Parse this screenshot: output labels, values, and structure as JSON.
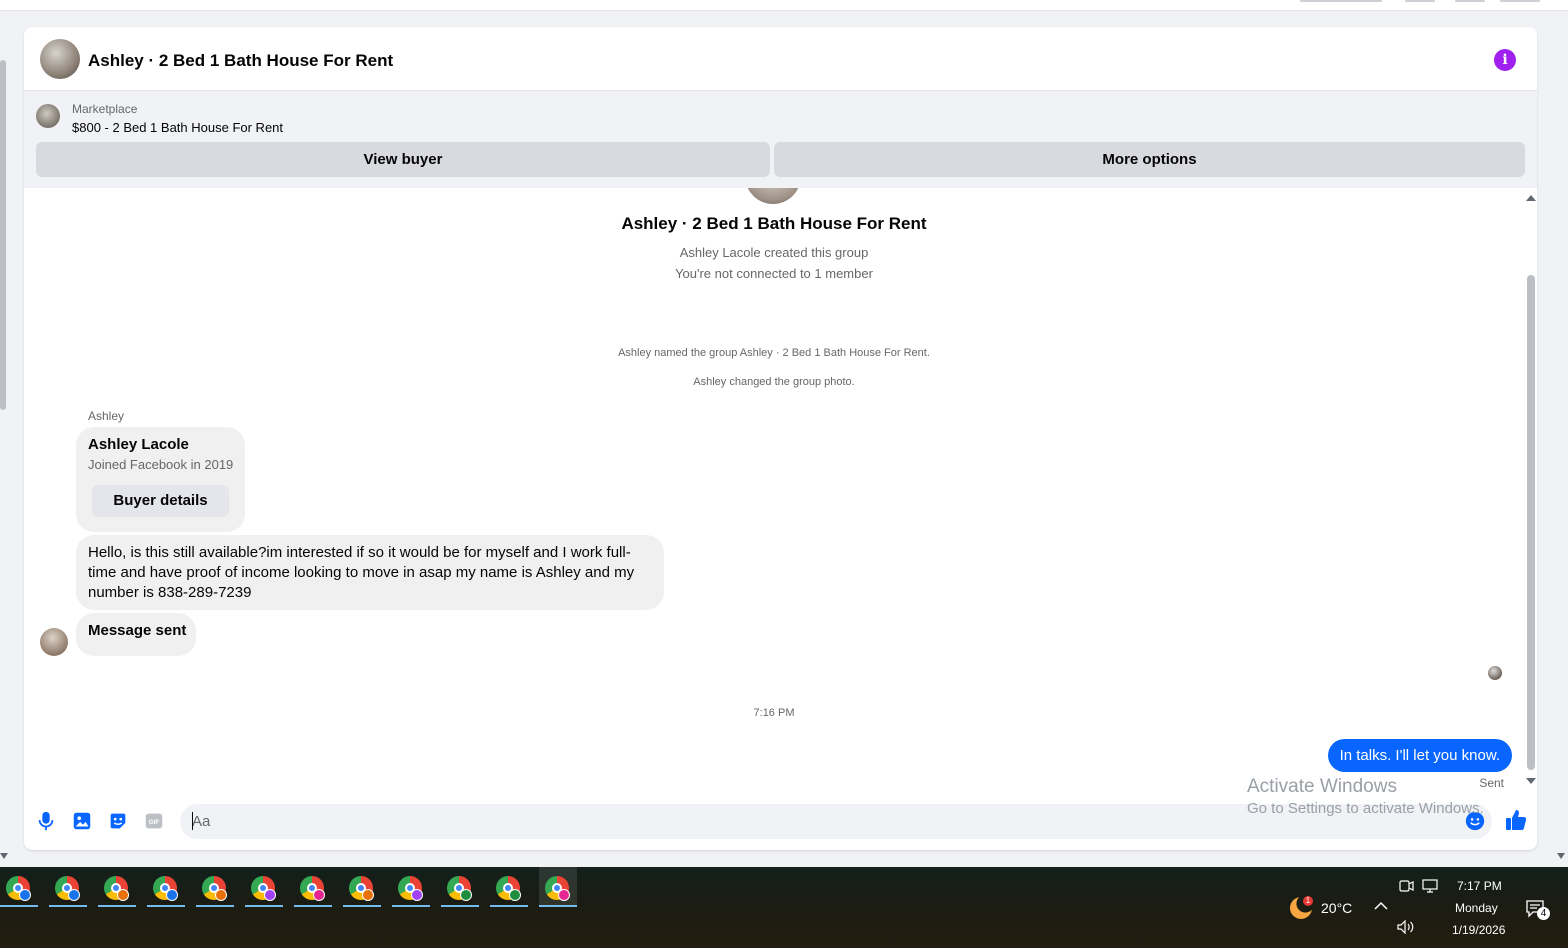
{
  "header": {
    "title": "Ashley · 2 Bed 1 Bath House For Rent",
    "info_label": "i"
  },
  "marketplace": {
    "label": "Marketplace",
    "listing": "$800 - 2 Bed 1 Bath House For Rent",
    "view_buyer": "View buyer",
    "more_options": "More options"
  },
  "thread": {
    "title": "Ashley · 2 Bed 1 Bath House For Rent",
    "created": "Ashley Lacole created this group",
    "connected": "You're not connected to 1 member",
    "sys_named": "Ashley named the group Ashley · 2 Bed 1 Bath House For Rent.",
    "sys_photo": "Ashley changed the group photo.",
    "sender": "Ashley",
    "card": {
      "name": "Ashley Lacole",
      "joined": "Joined Facebook in 2019",
      "button": "Buyer details"
    },
    "message": "Hello, is this still available?im interested if so it would be for myself and I work full-time and have proof of income looking to move in asap my name is Ashley and my number is 838-289-7239",
    "message_sent": "Message sent",
    "time": "7:16 PM",
    "my_message": "In talks. I'll let you know.",
    "status": "Sent"
  },
  "composer": {
    "placeholder": "Aa"
  },
  "watermark": {
    "line1": "Activate Windows",
    "line2": "Go to Settings to activate Windows."
  },
  "taskbar": {
    "temperature": "20°C",
    "weather_badge": "1",
    "time": "7:17 PM",
    "day": "Monday",
    "date": "1/19/2026",
    "notifications": "4",
    "app_badge_colors": [
      "#1a73e8",
      "#1a73e8",
      "#e8710a",
      "#1a73e8",
      "#e8710a",
      "#a142f4",
      "#e52592",
      "#e8710a",
      "#a142f4",
      "#1e8e3e",
      "#1e8e3e",
      "#e52592"
    ]
  },
  "colors": {
    "accent": "#0866ff",
    "info": "#a020f0",
    "bubble": "#f0f0f0"
  }
}
